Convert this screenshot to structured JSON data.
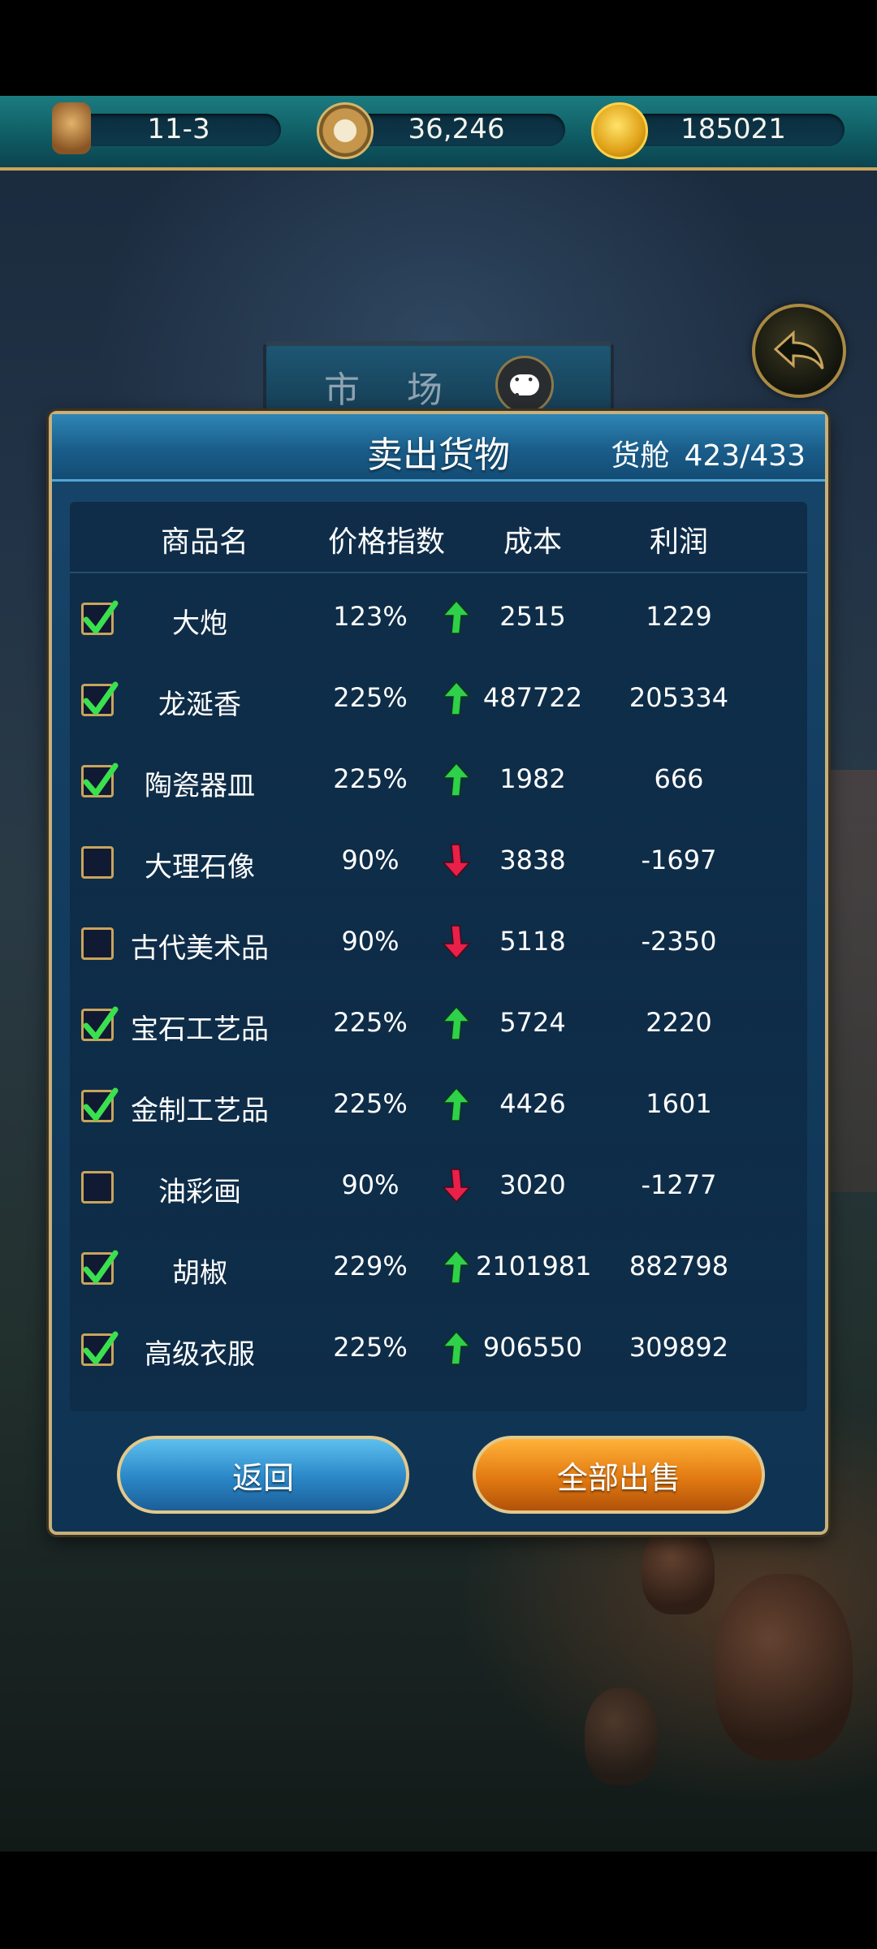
{
  "topbar": {
    "date": "11-3",
    "reputation": "36,246",
    "gold": "185021"
  },
  "market": {
    "title": "市 场"
  },
  "modal": {
    "title": "卖出货物",
    "cargo_label": "货舱",
    "cargo_value": "423/433",
    "columns": [
      "商品名",
      "价格指数",
      "成本",
      "利润"
    ],
    "rows": [
      {
        "checked": true,
        "name": "大炮",
        "index": "123%",
        "trend": "up",
        "cost": "2515",
        "profit": "1229"
      },
      {
        "checked": true,
        "name": "龙涎香",
        "index": "225%",
        "trend": "up",
        "cost": "487722",
        "profit": "205334"
      },
      {
        "checked": true,
        "name": "陶瓷器皿",
        "index": "225%",
        "trend": "up",
        "cost": "1982",
        "profit": "666"
      },
      {
        "checked": false,
        "name": "大理石像",
        "index": "90%",
        "trend": "down",
        "cost": "3838",
        "profit": "-1697"
      },
      {
        "checked": false,
        "name": "古代美术品",
        "index": "90%",
        "trend": "down",
        "cost": "5118",
        "profit": "-2350"
      },
      {
        "checked": true,
        "name": "宝石工艺品",
        "index": "225%",
        "trend": "up",
        "cost": "5724",
        "profit": "2220"
      },
      {
        "checked": true,
        "name": "金制工艺品",
        "index": "225%",
        "trend": "up",
        "cost": "4426",
        "profit": "1601"
      },
      {
        "checked": false,
        "name": "油彩画",
        "index": "90%",
        "trend": "down",
        "cost": "3020",
        "profit": "-1277"
      },
      {
        "checked": true,
        "name": "胡椒",
        "index": "229%",
        "trend": "up",
        "cost": "2101981",
        "profit": "882798"
      },
      {
        "checked": true,
        "name": "高级衣服",
        "index": "225%",
        "trend": "up",
        "cost": "906550",
        "profit": "309892"
      }
    ],
    "back_label": "返回",
    "sell_all_label": "全部出售"
  },
  "colors": {
    "arrow_up": "#2fd04a",
    "arrow_down": "#e8204a",
    "check": "#3be04e",
    "accent_gold": "#c9a45b"
  }
}
